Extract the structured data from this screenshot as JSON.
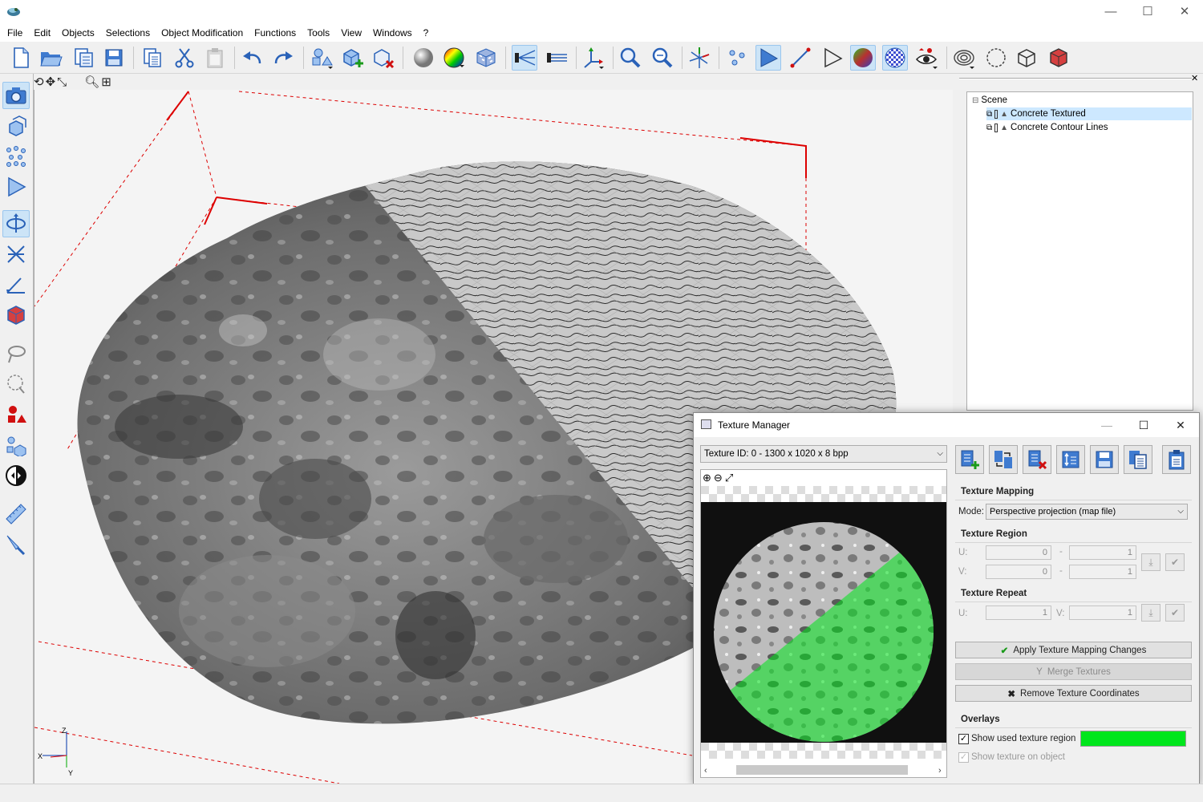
{
  "window": {
    "title": "",
    "minimize": "—",
    "maximize": "☐",
    "close": "✕"
  },
  "menu": [
    "File",
    "Edit",
    "Objects",
    "Selections",
    "Object Modification",
    "Functions",
    "Tools",
    "View",
    "Windows",
    "?"
  ],
  "scene": {
    "root": "Scene",
    "items": [
      {
        "label": "Concrete Textured",
        "selected": true
      },
      {
        "label": "Concrete Contour Lines",
        "selected": false
      }
    ]
  },
  "axes": {
    "x": "X",
    "y": "Y",
    "z": "Z"
  },
  "texture_manager": {
    "title": "Texture Manager",
    "texture_id": "Texture ID: 0 - 1300 x 1020 x 8 bpp",
    "mapping": {
      "label": "Texture Mapping",
      "mode_label": "Mode:",
      "mode_value": "Perspective projection (map file)"
    },
    "region": {
      "label": "Texture Region",
      "u_label": "U:",
      "v_label": "V:",
      "u_from": "0",
      "u_to": "1",
      "v_from": "0",
      "v_to": "1",
      "dash": "-"
    },
    "repeat": {
      "label": "Texture Repeat",
      "u_label": "U:",
      "v_label": "V:",
      "u": "1",
      "v": "1"
    },
    "buttons": {
      "apply": "Apply Texture Mapping Changes",
      "merge": "Merge Textures",
      "remove": "Remove Texture Coordinates"
    },
    "overlays": {
      "label": "Overlays",
      "show_used_region": "Show used texture region",
      "show_on_object": "Show texture on object",
      "region_color": "#00e61c"
    }
  },
  "colors": {
    "accent": "#cce4f7",
    "selection": "#cde8ff",
    "bbox": "#dd0000",
    "overlay_green": "#00e61c"
  }
}
